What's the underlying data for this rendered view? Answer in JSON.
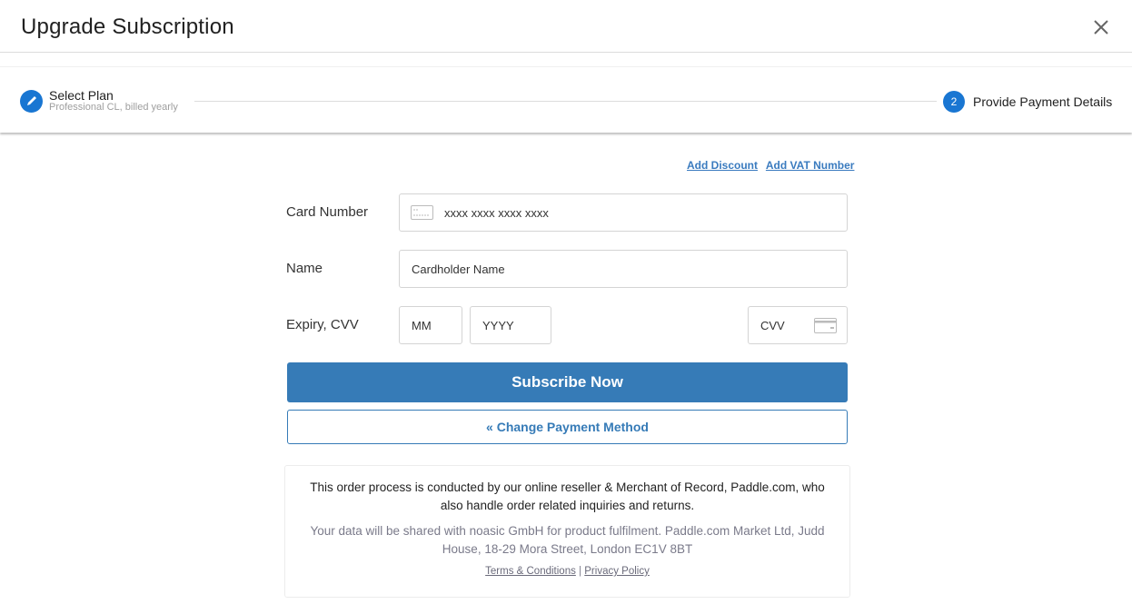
{
  "header": {
    "title": "Upgrade Subscription",
    "close_icon": "close-icon"
  },
  "stepper": {
    "steps": [
      {
        "label": "Select Plan",
        "sublabel": "Professional CL, billed yearly",
        "icon": "edit-pencil-icon",
        "state": "completed"
      },
      {
        "number": "2",
        "label": "Provide Payment Details",
        "state": "active"
      }
    ]
  },
  "links": {
    "add_discount": "Add Discount",
    "add_vat": "Add VAT Number"
  },
  "form": {
    "card_number": {
      "label": "Card Number",
      "placeholder": "xxxx xxxx xxxx xxxx",
      "icon": "credit-card-icon"
    },
    "name": {
      "label": "Name",
      "placeholder": "Cardholder Name"
    },
    "expiry": {
      "label": "Expiry, CVV",
      "month_placeholder": "MM",
      "year_placeholder": "YYYY"
    },
    "cvv": {
      "placeholder": "CVV",
      "icon": "card-back-icon"
    }
  },
  "buttons": {
    "subscribe": "Subscribe Now",
    "change_method": "« Change Payment Method"
  },
  "notice": {
    "main": "This order process is conducted by our online reseller & Merchant of Record, Paddle.com, who also handle order related inquiries and returns.",
    "data": "Your data will be shared with noasic GmbH for product fulfilment. Paddle.com Market Ltd, Judd House, 18-29 Mora Street, London EC1V 8BT",
    "terms": "Terms & Conditions",
    "separator": "|",
    "privacy": "Privacy Policy"
  },
  "colors": {
    "accent": "#1976d2",
    "button": "#367bb7",
    "link": "#3a7bbf"
  }
}
